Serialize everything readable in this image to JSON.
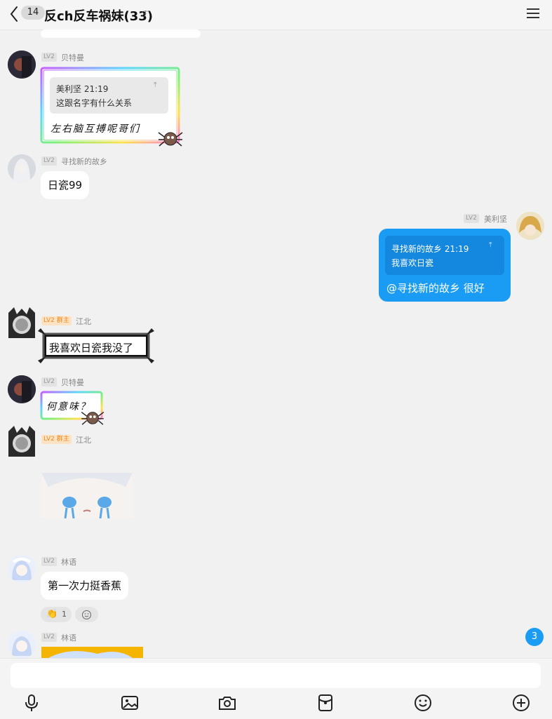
{
  "header": {
    "unread_count": "14",
    "chat_title": "反ch反车祸妹(33)",
    "ear_glyph": "ℱ"
  },
  "messages": [
    {
      "level": "LV2",
      "nick": "贝特曼",
      "quote_author": "美利坚 21:19",
      "quote_text": "这跟名字有什么关系",
      "sticker_text": "左右脑互搏呢哥们"
    },
    {
      "level": "LV2",
      "nick": "寻找新的故乡",
      "text": "日瓷99"
    },
    {
      "level": "LV2",
      "nick": "美利坚",
      "quote_author": "寻找新的故乡 21:19",
      "quote_text": "我喜欢日瓷",
      "text": "@寻找新的故乡 很好"
    },
    {
      "level": "LV2",
      "owner_badge": "群主",
      "nick": "江北",
      "sticker_text": "我喜欢日瓷我没了"
    },
    {
      "level": "LV2",
      "nick": "贝特曼",
      "sticker_text": "何意味？"
    },
    {
      "level": "LV2",
      "owner_badge": "群主",
      "nick": "江北"
    },
    {
      "level": "LV2",
      "nick": "林语",
      "text": "第一次力挺香蕉",
      "reaction_count": "1"
    },
    {
      "level": "LV2",
      "nick": "林语"
    }
  ],
  "unread_badge": "3",
  "icons": {
    "back": "chevron-left-icon",
    "menu": "menu-icon",
    "voice": "microphone-icon",
    "image": "image-icon",
    "camera": "camera-icon",
    "redpacket": "red-packet-icon",
    "emoji": "emoji-icon",
    "plus": "plus-icon"
  },
  "colors": {
    "accent": "#1a9cf5",
    "owner": "#f08a1c"
  }
}
